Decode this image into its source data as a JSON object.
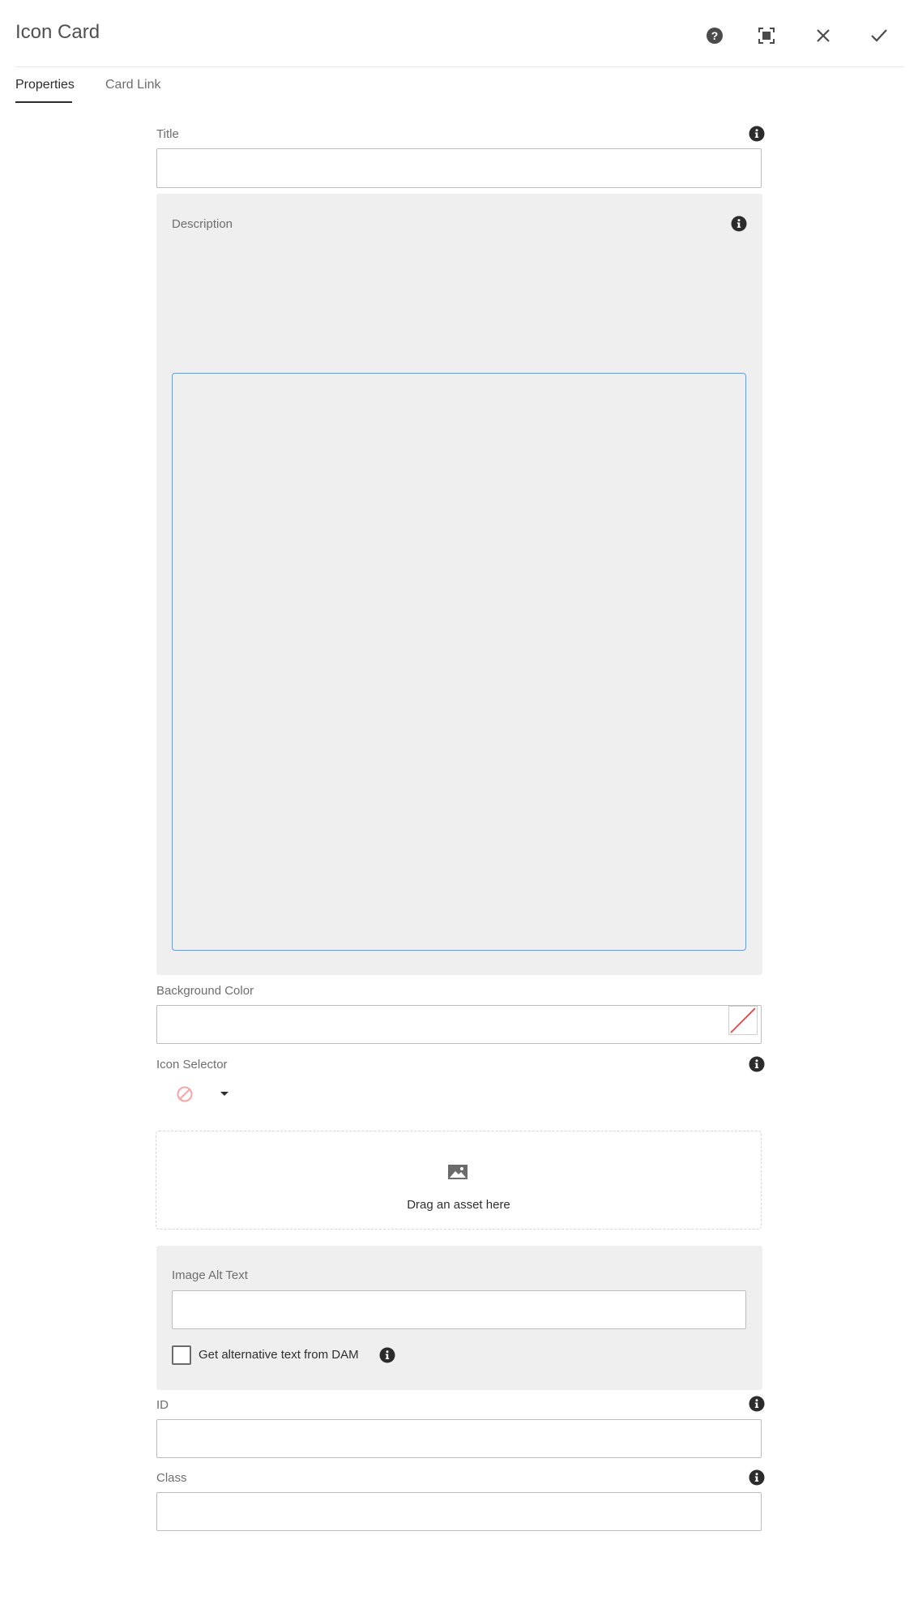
{
  "dialog": {
    "title": "Icon Card",
    "actions": [
      "help-icon",
      "fullscreen-icon",
      "close-icon",
      "checkmark-icon"
    ]
  },
  "tabs": [
    {
      "label": "Properties",
      "active": true
    },
    {
      "label": "Card Link",
      "active": false
    }
  ],
  "fields": {
    "title": {
      "label": "Title",
      "value": ""
    },
    "description": {
      "label": "Description",
      "value": ""
    },
    "background_color": {
      "label": "Background Color",
      "value": ""
    },
    "icon_selector": {
      "label": "Icon Selector",
      "selected": "none-icon"
    },
    "asset": {
      "dropzone_text": "Drag an asset here"
    },
    "image_alt_text": {
      "label": "Image Alt Text",
      "value": ""
    },
    "alt_from_dam": {
      "label": "Get alternative text from DAM",
      "checked": false
    },
    "id": {
      "label": "ID",
      "value": ""
    },
    "class": {
      "label": "Class",
      "value": ""
    }
  },
  "colors": {
    "accent_focus": "#6c9bd8",
    "panel_bg": "#efefef",
    "no_color_slash": "#e03a3a",
    "disabled_icon": "#f3a6a6"
  }
}
